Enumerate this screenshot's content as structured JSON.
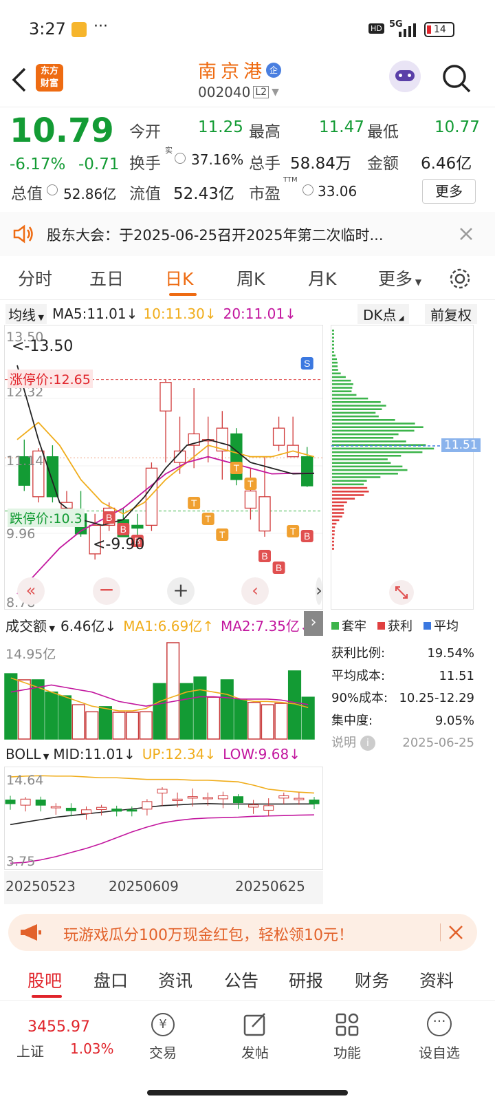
{
  "status": {
    "time": "3:27",
    "dots": "···",
    "hd": "HD",
    "net": "5G",
    "battery": "14"
  },
  "header": {
    "name": "南京港",
    "badge": "企",
    "code": "002040",
    "level": "L2",
    "logo_line1": "东方",
    "logo_line2": "财富"
  },
  "quote": {
    "price": "10.79",
    "pct": "-6.17%",
    "chg": "-0.71",
    "open_l": "今开",
    "open_v": "11.25",
    "high_l": "最高",
    "high_v": "11.47",
    "low_l": "最低",
    "low_v": "10.77",
    "turn_l": "换手",
    "turn_sup": "实",
    "turn_v": "37.16%",
    "vol_l": "总手",
    "vol_v": "58.84万",
    "amt_l": "金额",
    "amt_v": "6.46亿",
    "mcap_l": "总值",
    "mcap_v": "52.86亿",
    "float_l": "流值",
    "float_v": "52.43亿",
    "pe_l": "市盈",
    "pe_sup": "TTM",
    "pe_v": "33.06",
    "more": "更多"
  },
  "notice": {
    "text": "股东大会：于2025-06-25召开2025年第二次临时..."
  },
  "tabs": [
    "分时",
    "五日",
    "日K",
    "周K",
    "月K",
    "更多"
  ],
  "ma": {
    "sel": "均线",
    "ma5": "MA5:11.01",
    "ma10": "10:11.30",
    "ma20": "20:11.01",
    "dk": "DK点",
    "fq": "前复权"
  },
  "chart_labels": {
    "y_top": "13.50",
    "y2": "12.32",
    "y3": "11.14",
    "y4": "9.96",
    "y_bot": "8.78",
    "hi_mark": "<-13.50",
    "lo_mark": "<-9.90",
    "limit_up": "涨停价:12.65",
    "limit_down": "跌停价:10.3",
    "side_price": "11.51",
    "sig_s": "S",
    "sig_b": "B",
    "sig_t": "T"
  },
  "volbar": {
    "sel": "成交额",
    "val": "6.46亿",
    "ma1": "MA1:6.69亿",
    "ma2": "MA2:7.35亿",
    "top": "14.95亿"
  },
  "boll": {
    "sel": "BOLL",
    "mid": "MID:11.01",
    "up": "UP:12.34",
    "low": "LOW:9.68",
    "top": "14.64",
    "bot": "3.75"
  },
  "dates": [
    "20250523",
    "20250609",
    "20250625"
  ],
  "legend": {
    "a": "套牢",
    "b": "获利",
    "c": "平均"
  },
  "stats": [
    {
      "k": "获利比例:",
      "v": "19.54%"
    },
    {
      "k": "平均成本:",
      "v": "11.51"
    },
    {
      "k": "90%成本:",
      "v": "10.25-12.29"
    },
    {
      "k": "集中度:",
      "v": "9.05%"
    }
  ],
  "stats_note": {
    "k": "说明",
    "date": "2025-06-25"
  },
  "promo": {
    "text": "玩游戏瓜分100万现金红包，轻松领10元！"
  },
  "subtabs": [
    "股吧",
    "盘口",
    "资讯",
    "公告",
    "研报",
    "财务",
    "资料"
  ],
  "bottom": {
    "idx_name": "上证",
    "idx_val": "3455.97",
    "idx_pct": "1.03%",
    "trade": "交易",
    "post": "发帖",
    "func": "功能",
    "watch": "设自选",
    "trade_sym": "¥"
  },
  "chart_data": {
    "type": "candlestick",
    "title": "",
    "x": [
      "20250523",
      "20250609",
      "20250625"
    ],
    "ylim": [
      8.78,
      13.5
    ],
    "candles": [
      [
        11.3,
        10.8,
        11.6,
        10.7
      ],
      [
        10.6,
        11.4,
        11.45,
        10.5
      ],
      [
        11.3,
        10.6,
        11.5,
        10.5
      ],
      [
        10.4,
        10.5,
        10.7,
        10.1
      ],
      [
        10.3,
        9.95,
        10.7,
        9.9
      ],
      [
        9.6,
        10.1,
        10.3,
        9.5
      ],
      [
        10.1,
        10.4,
        10.5,
        10.0
      ],
      [
        10.2,
        9.9,
        10.4,
        9.9
      ],
      [
        10.1,
        10.05,
        10.3,
        9.9
      ],
      [
        10.1,
        11.1,
        11.2,
        10.0
      ],
      [
        12.1,
        12.6,
        12.65,
        11.2
      ],
      [
        11.2,
        11.4,
        12.0,
        11.0
      ],
      [
        11.5,
        11.7,
        12.5,
        11.1
      ],
      [
        11.6,
        11.6,
        12.0,
        11.2
      ],
      [
        11.4,
        11.8,
        12.1,
        10.9
      ],
      [
        11.7,
        10.9,
        11.8,
        10.8
      ],
      [
        10.4,
        10.7,
        11.1,
        10.2
      ],
      [
        10.0,
        10.6,
        11.3,
        9.9
      ],
      [
        11.5,
        11.8,
        12.0,
        11.4
      ],
      [
        11.3,
        11.5,
        12.0,
        11.3
      ],
      [
        11.3,
        10.79,
        11.47,
        10.77
      ]
    ],
    "ma5": [
      12.9,
      11.6,
      10.5,
      10.2,
      10.1,
      10.2,
      10.6,
      11.1,
      11.5,
      11.6,
      11.5,
      11.2,
      11.1,
      11.0,
      11.01
    ],
    "ma10": [
      11.6,
      11.9,
      11.5,
      10.9,
      10.5,
      10.3,
      10.5,
      10.9,
      11.2,
      11.5,
      11.4,
      11.3,
      11.3,
      11.4,
      11.3
    ],
    "ma20": [
      8.9,
      9.3,
      9.7,
      10.0,
      10.2,
      10.4,
      10.7,
      11.0,
      11.2,
      11.3,
      11.2,
      11.1,
      11.0,
      11.01,
      11.01
    ],
    "volume": [
      13.9,
      12.6,
      12.6,
      10.0,
      9.2,
      7.3,
      5.8,
      6.9,
      5.7,
      5.7,
      5.8,
      11.8,
      20.5,
      11.8,
      13.2,
      8.9,
      12.6,
      8.4,
      7.8,
      7.3,
      7.6,
      14.5,
      8.9
    ]
  }
}
